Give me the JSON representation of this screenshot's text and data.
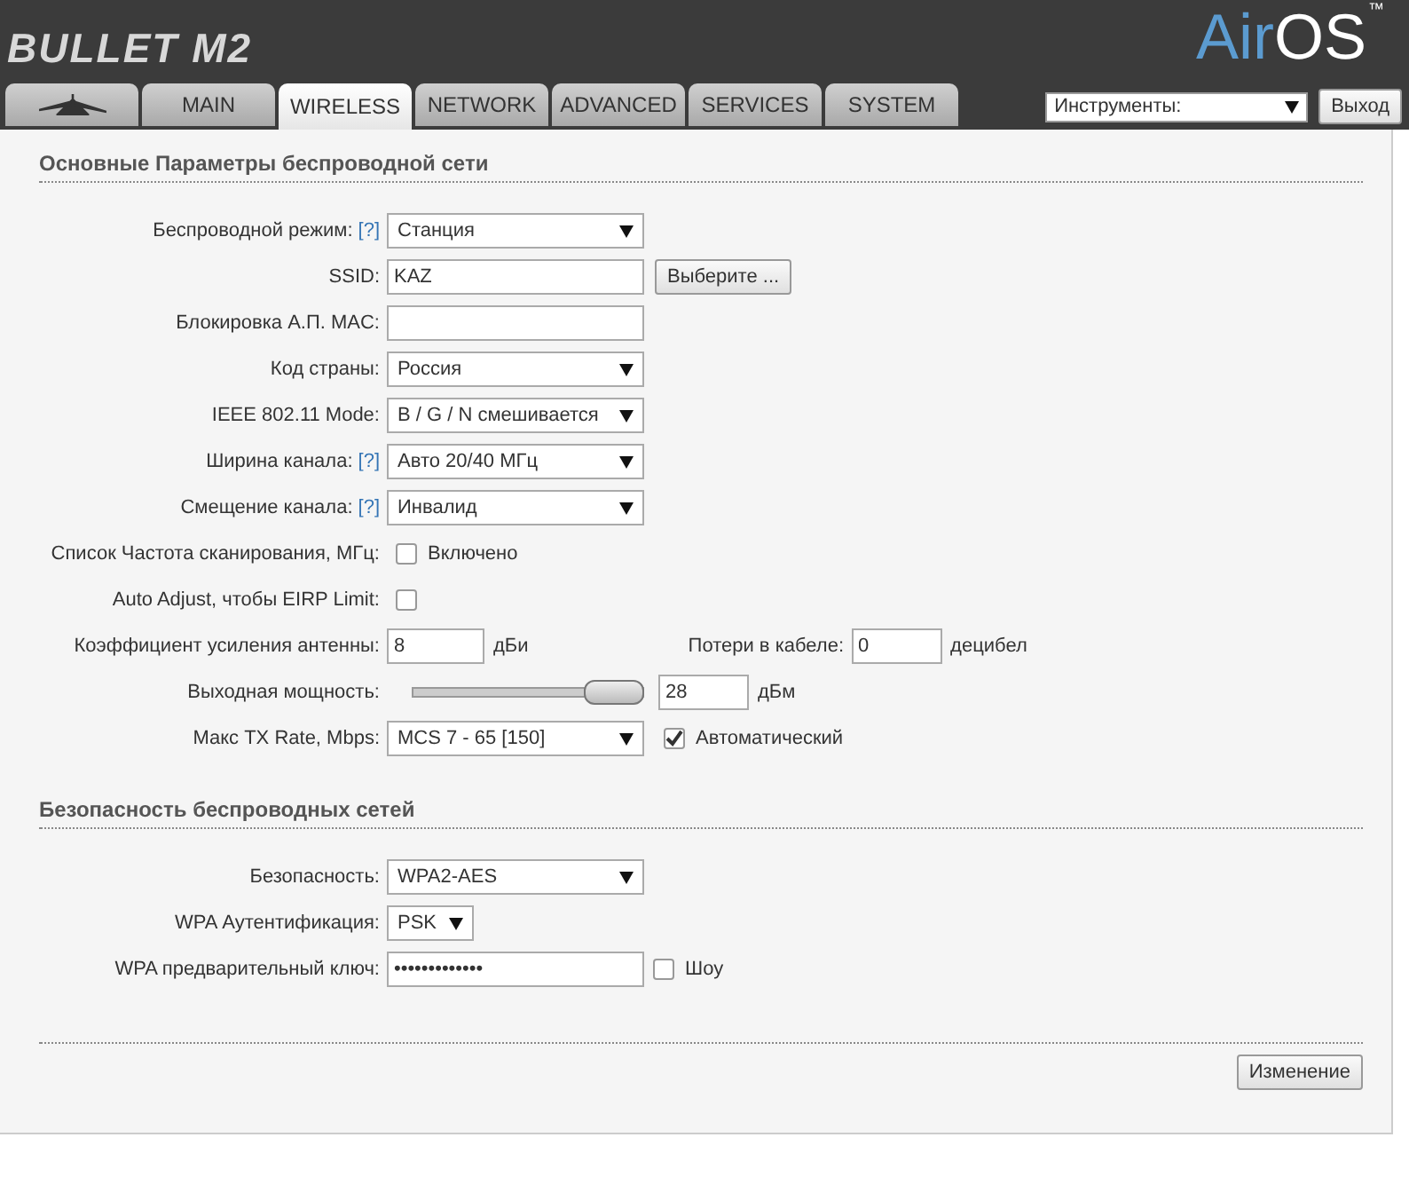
{
  "header": {
    "product": "BULLET M2",
    "brand_prefix": "Air",
    "brand_suffix": "OS",
    "trademark": "™"
  },
  "tabs": [
    {
      "kind": "icon",
      "selected": false
    },
    {
      "kind": "text",
      "label": "MAIN",
      "selected": false
    },
    {
      "kind": "text",
      "label": "WIRELESS",
      "selected": true
    },
    {
      "kind": "text",
      "label": "NETWORK",
      "selected": false
    },
    {
      "kind": "text",
      "label": "ADVANCED",
      "selected": false
    },
    {
      "kind": "text",
      "label": "SERVICES",
      "selected": false
    },
    {
      "kind": "text",
      "label": "SYSTEM",
      "selected": false
    }
  ],
  "tools": {
    "select": "Инструменты:",
    "logout": "Выход"
  },
  "sections": [
    {
      "title": "Основные Параметры беспроводной сети",
      "rows": [
        {
          "kind": "select",
          "label": "Беспроводной режим:",
          "help": "[?]",
          "value": "Станция"
        },
        {
          "kind": "text",
          "label": "SSID:",
          "value": "KAZ",
          "button": "Выберите ..."
        },
        {
          "kind": "text",
          "label": "Блокировка А.П. MAC:"
        },
        {
          "kind": "select",
          "label": "Код страны:",
          "value": "Россия"
        },
        {
          "kind": "select",
          "label": "IEEE 802.11 Mode:",
          "value": "B / G / N смешивается"
        },
        {
          "kind": "select",
          "label": "Ширина канала:",
          "help": "[?]",
          "value": "Авто 20/40 МГц"
        },
        {
          "kind": "select",
          "label": "Смещение канала:",
          "help": "[?]",
          "value": "Инвалид"
        },
        {
          "kind": "checkbox",
          "label": "Список Частота сканирования, МГц:",
          "checked": false,
          "text": "Включено"
        },
        {
          "kind": "checkbox",
          "label": "Auto Adjust, чтобы EIRP Limit:",
          "checked": false
        },
        {
          "kind": "pair",
          "label": "Коэффициент усиления антенны:",
          "value": "8",
          "unit": "дБи",
          "label2": "Потери в кабеле:",
          "value2": "0",
          "unit2": "децибел"
        },
        {
          "kind": "slider",
          "label": "Выходная мощность:",
          "level": 1,
          "value": "28",
          "unit": "дБм"
        },
        {
          "kind": "select",
          "label": "Макс TX Rate, Mbps:",
          "value": "MCS 7 - 65 [150]",
          "checked": true,
          "text": "Автоматический"
        }
      ]
    },
    {
      "title": "Безопасность беспроводных сетей",
      "rows": [
        {
          "kind": "select",
          "label": "Безопасность:",
          "value": "WPA2-AES"
        },
        {
          "kind": "smallselect",
          "label": "WPA Аутентификация:",
          "value": "PSK"
        },
        {
          "kind": "password",
          "label": "WPA предварительный ключ:",
          "value": "•••••••••••••",
          "checked": false,
          "text": "Шоу"
        }
      ]
    }
  ],
  "submit": "Изменение"
}
